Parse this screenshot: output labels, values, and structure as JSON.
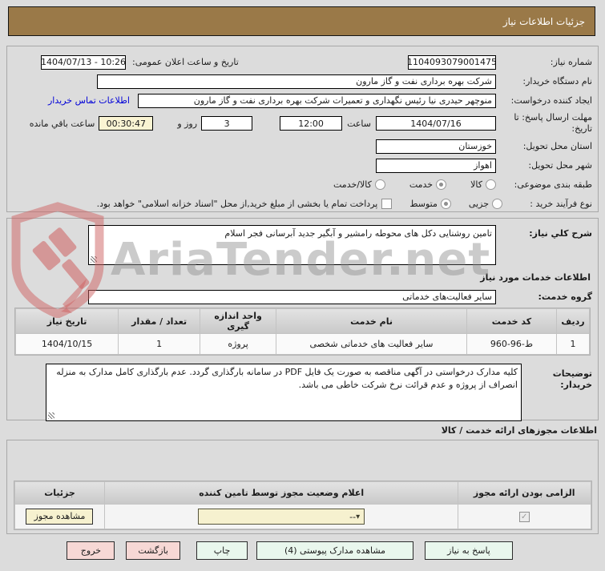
{
  "page": {
    "title": "جزئیات اطلاعات نیاز"
  },
  "form": {
    "need_number": {
      "label": "شماره نیاز:",
      "value": "1104093079001475"
    },
    "announce": {
      "label": "تاریخ و ساعت اعلان عمومی:",
      "value": "1404/07/13 - 10:26"
    },
    "buyer_org": {
      "label": "نام دستگاه خریدار:",
      "value": "شرکت بهره برداری نفت و گاز مارون"
    },
    "creator": {
      "label": "ایجاد کننده درخواست:",
      "value": "منوچهر حیدری نیا رئیس نگهداری و تعمیرات شرکت بهره برداری نفت و گاز مارون",
      "contact_link": "اطلاعات تماس خریدار"
    },
    "deadline": {
      "label": "مهلت ارسال پاسخ: تا تاریخ:",
      "date": "1404/07/16",
      "hour_label": "ساعت",
      "time": "12:00",
      "days": "3",
      "days_label": "روز و",
      "countdown": "00:30:47",
      "countdown_label": "ساعت باقي مانده"
    },
    "province": {
      "label": "استان محل تحویل:",
      "value": "خوزستان"
    },
    "city": {
      "label": "شهر محل تحویل:",
      "value": "اهواز"
    },
    "category": {
      "label": "طبقه بندی موضوعی:",
      "options": [
        {
          "label": "کالا",
          "selected": false
        },
        {
          "label": "خدمت",
          "selected": true
        },
        {
          "label": "کالا/خدمت",
          "selected": false
        }
      ]
    },
    "process": {
      "label": "نوع فرآیند خرید :",
      "options": [
        {
          "label": "جزيی",
          "selected": false
        },
        {
          "label": "متوسط",
          "selected": true
        }
      ],
      "treasury_note": "پرداخت تمام یا بخشی از مبلغ خرید,از محل \"اسناد خزانه اسلامی\" خواهد بود."
    }
  },
  "need_desc": {
    "label": "شرح کلي نیاز:",
    "value": "تامین روشنایی دکل های محوطه رامشیر و آبگیر جدید آبرسانی فجر اسلام"
  },
  "services": {
    "title": "اطلاعات خدمات مورد نیاز",
    "group": {
      "label": "گروه خدمت:",
      "value": "سایر فعالیت‌های خدماتی"
    },
    "table": {
      "headers": [
        "ردیف",
        "کد خدمت",
        "نام خدمت",
        "واحد اندازه گیری",
        "تعداد / مقدار",
        "تاریخ نیاز"
      ],
      "rows": [
        [
          "1",
          "ط-96-960",
          "سایر فعالیت های خدماتی شخصی",
          "پروژه",
          "1",
          "1404/10/15"
        ]
      ]
    },
    "notes": {
      "label": "توضیحات خریدار:",
      "value": "کلیه مدارک درخواستی در آگهی مناقصه به صورت یک فایل PDF در سامانه بارگذاری گردد. عدم بارگذاری کامل مدارک به منزله انصراف از پروژه و عدم قرائت نرخ شرکت خاطی می باشد."
    }
  },
  "licenses": {
    "title": "اطلاعات مجوزهای ارائه خدمت / کالا",
    "table": {
      "headers": [
        "الزامی بودن ارائه مجوز",
        "اعلام وضعیت مجوز توسط تامین کننده",
        "جزئیات"
      ],
      "status_value": "--",
      "details_button": "مشاهده مجوز"
    }
  },
  "actions": {
    "respond": "پاسخ به نیاز",
    "attachments": "مشاهده مدارک پیوستی (4)",
    "print": "چاپ",
    "back": "بازگشت",
    "exit": "خروج"
  },
  "watermark": {
    "text": "AriaTender.net"
  },
  "icons": {
    "check": "✓",
    "chevron_down": "▾"
  },
  "colors": {
    "header": "#9a7948",
    "highlight": "#faf4d3",
    "button_green": "#e9f7ed",
    "button_pink": "#f7d8d5",
    "link": "#0000d8"
  }
}
